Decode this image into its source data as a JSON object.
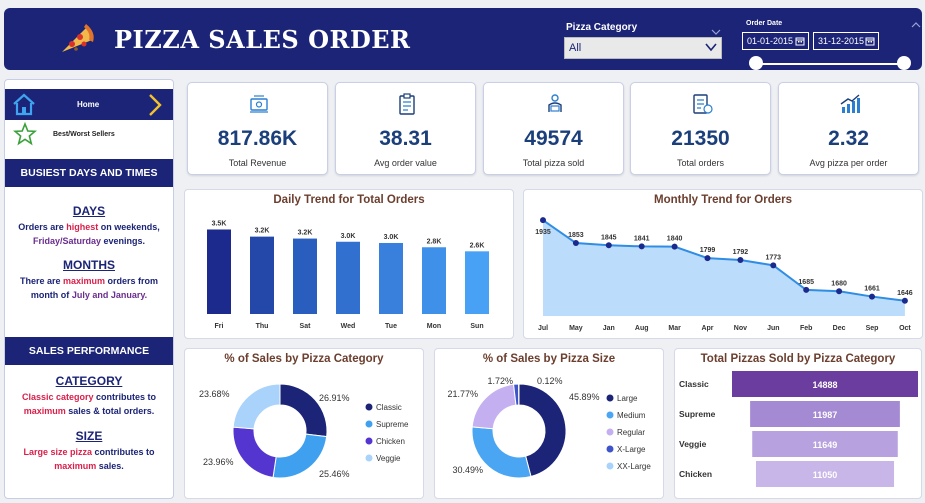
{
  "header": {
    "title": "PIZZA SALES ORDER",
    "category_label": "Pizza Category",
    "category_value": "All",
    "date_label": "Order Date",
    "date_start": "01-01-2015",
    "date_end": "31-12-2015"
  },
  "nav": {
    "home_label": "Home",
    "best_label": "Best/Worst Sellers"
  },
  "insights": {
    "busiest_title": "BUSIEST DAYS AND TIMES",
    "days_heading": "DAYS",
    "days_line1_a": "Orders are ",
    "days_line1_b": "highest",
    "days_line1_c": " on weekends,",
    "days_line2_a": "Friday/Saturday",
    "days_line2_b": " evenings.",
    "months_heading": "MONTHS",
    "months_line1_a": "There are ",
    "months_line1_b": "maximum",
    "months_line1_c": " orders from",
    "months_line2_a": "month of ",
    "months_line2_b": "July and January.",
    "perf_title": "SALES PERFORMANCE",
    "category_heading": "CATEGORY",
    "cat_line1_a": "Classic category",
    "cat_line1_b": " contributes to",
    "cat_line2_a": "maximum",
    "cat_line2_b": " sales & total orders.",
    "size_heading": "SIZE",
    "size_line1_a": "Large size pizza",
    "size_line1_b": " contributes to",
    "size_line2_a": "maximum",
    "size_line2_b": " sales."
  },
  "kpis": [
    {
      "value": "817.86K",
      "label": "Total Revenue",
      "icon": "money-icon"
    },
    {
      "value": "38.31",
      "label": "Avg order value",
      "icon": "clipboard-icon"
    },
    {
      "value": "49574",
      "label": "Total pizza sold",
      "icon": "delivery-icon"
    },
    {
      "value": "21350",
      "label": "Total orders",
      "icon": "order-list-icon"
    },
    {
      "value": "2.32",
      "label": "Avg pizza per order",
      "icon": "bar-growth-icon"
    }
  ],
  "colors": {
    "navy": "#1b2476",
    "title_brown": "#6b3e2e",
    "highlight_red": "#d91f4a",
    "highlight_purple": "#6a2e8f"
  },
  "chart_data": [
    {
      "type": "bar",
      "title": "Daily Trend for Total Orders",
      "categories": [
        "Fri",
        "Thu",
        "Sat",
        "Wed",
        "Tue",
        "Mon",
        "Sun"
      ],
      "values": [
        3538,
        3239,
        3158,
        3024,
        2973,
        2794,
        2624
      ],
      "data_labels": [
        "3.5K",
        "3.2K",
        "3.2K",
        "3.0K",
        "3.0K",
        "2.8K",
        "2.6K"
      ],
      "colors": [
        "#1b2a8c",
        "#2348a9",
        "#2a5ebe",
        "#3170cf",
        "#3880dc",
        "#3f90e8",
        "#49a1f5"
      ]
    },
    {
      "type": "area",
      "title": "Monthly Trend for Orders",
      "categories": [
        "Jul",
        "May",
        "Jan",
        "Aug",
        "Mar",
        "Apr",
        "Nov",
        "Jun",
        "Feb",
        "Dec",
        "Sep",
        "Oct"
      ],
      "values": [
        1935,
        1853,
        1845,
        1841,
        1840,
        1799,
        1792,
        1773,
        1685,
        1680,
        1661,
        1646
      ]
    },
    {
      "type": "pie",
      "title": "% of Sales by Pizza Category",
      "labels": [
        "Classic",
        "Supreme",
        "Chicken",
        "Veggie"
      ],
      "values": [
        26.91,
        25.46,
        23.96,
        23.68
      ],
      "value_labels": [
        "26.91%",
        "25.46%",
        "23.96%",
        "23.68%"
      ],
      "colors": [
        "#1b2476",
        "#3fa0f0",
        "#5535d0",
        "#a9d3fb"
      ]
    },
    {
      "type": "pie",
      "title": "% of Sales by Pizza Size",
      "labels": [
        "Large",
        "Medium",
        "Regular",
        "X-Large",
        "XX-Large"
      ],
      "values": [
        45.89,
        30.49,
        21.77,
        1.72,
        0.12
      ],
      "value_labels": [
        "45.89%",
        "30.49%",
        "21.77%",
        "1.72%",
        "0.12%"
      ],
      "colors": [
        "#1b2476",
        "#4aa6f2",
        "#c4b0f0",
        "#3d55c8",
        "#a9d3fb"
      ]
    },
    {
      "type": "bar",
      "title": "Total Pizzas Sold by Pizza Category",
      "categories": [
        "Classic",
        "Supreme",
        "Veggie",
        "Chicken"
      ],
      "values": [
        14888,
        11987,
        11649,
        11050
      ],
      "colors": [
        "#6a3d9e",
        "#a48ad2",
        "#b7a1de",
        "#c8b6e8"
      ]
    }
  ]
}
